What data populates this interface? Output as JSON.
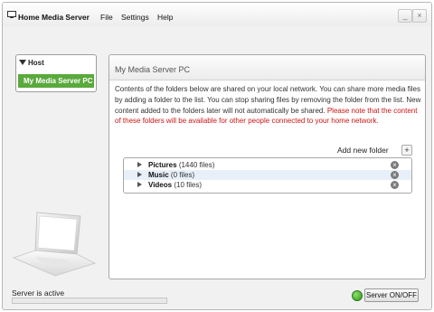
{
  "app": {
    "title": "Home Media Server"
  },
  "menu": [
    "File",
    "Settings",
    "Help"
  ],
  "window_controls": {
    "minimize": "_",
    "close": "×"
  },
  "sidebar": {
    "header": "Host",
    "items": [
      {
        "label": "My Media Server PC",
        "selected": true
      }
    ]
  },
  "panel": {
    "title": "My Media Server PC",
    "description": "Contents of the folders below are shared on your local network. You can share more media files by adding a folder to the list. You can stop sharing files by removing the folder from the list. New content added to the folders later will not automatically be shared.",
    "warning": "Please note that the content of these folders will be available for other people connected to your home network.",
    "add_folder_label": "Add new folder",
    "add_folder_icon": "+",
    "folders": [
      {
        "name": "Pictures",
        "count": "(1440 files)"
      },
      {
        "name": "Music",
        "count": "(0 files)"
      },
      {
        "name": "Videos",
        "count": "(10 files)"
      }
    ],
    "remove_icon": "×"
  },
  "status": {
    "text": "Server is active",
    "progress": 0.0,
    "server_button_label": "Server ON/OFF",
    "server_led_color": "#3aae24"
  },
  "colors": {
    "accent": "#5aa93c",
    "warning": "#cc1414",
    "row_highlight": "#e7f0f8"
  }
}
